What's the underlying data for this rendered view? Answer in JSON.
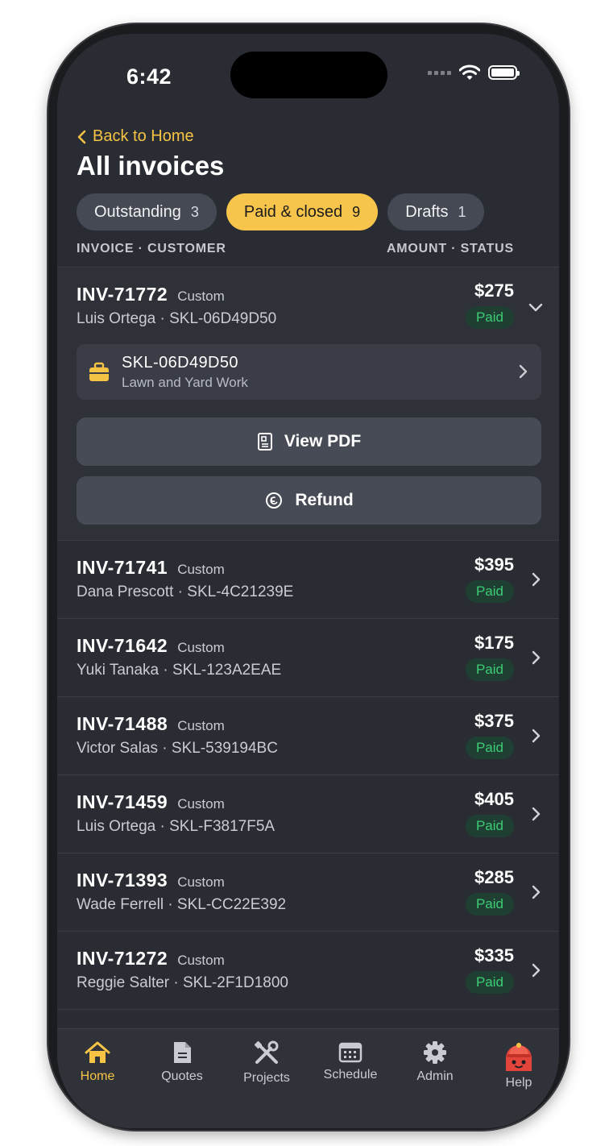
{
  "status_bar": {
    "time": "6:42"
  },
  "header": {
    "back_label": "Back to Home",
    "title": "All invoices"
  },
  "filters": [
    {
      "label": "Outstanding",
      "count": "3"
    },
    {
      "label": "Paid & closed",
      "count": "9"
    },
    {
      "label": "Drafts",
      "count": "1"
    }
  ],
  "columns": {
    "left": "INVOICE · CUSTOMER",
    "right": "AMOUNT · STATUS"
  },
  "expanded_invoice": {
    "id": "INV-71772",
    "type": "Custom",
    "sub": "Luis Ortega · SKL-06D49D50",
    "amount": "$275",
    "status": "Paid",
    "project": {
      "code": "SKL-06D49D50",
      "name": "Lawn and Yard Work"
    },
    "actions": {
      "view_pdf": "View PDF",
      "refund": "Refund"
    }
  },
  "invoices": [
    {
      "id": "INV-71741",
      "type": "Custom",
      "sub": "Dana Prescott · SKL-4C21239E",
      "amount": "$395",
      "status": "Paid"
    },
    {
      "id": "INV-71642",
      "type": "Custom",
      "sub": "Yuki Tanaka · SKL-123A2EAE",
      "amount": "$175",
      "status": "Paid"
    },
    {
      "id": "INV-71488",
      "type": "Custom",
      "sub": "Victor Salas · SKL-539194BC",
      "amount": "$375",
      "status": "Paid"
    },
    {
      "id": "INV-71459",
      "type": "Custom",
      "sub": "Luis Ortega · SKL-F3817F5A",
      "amount": "$405",
      "status": "Paid"
    },
    {
      "id": "INV-71393",
      "type": "Custom",
      "sub": "Wade Ferrell · SKL-CC22E392",
      "amount": "$285",
      "status": "Paid"
    },
    {
      "id": "INV-71272",
      "type": "Custom",
      "sub": "Reggie Salter · SKL-2F1D1800",
      "amount": "$335",
      "status": "Paid"
    }
  ],
  "tab_bar": [
    {
      "label": "Home",
      "icon": "home-icon",
      "active": true
    },
    {
      "label": "Quotes",
      "icon": "document-icon"
    },
    {
      "label": "Projects",
      "icon": "tools-icon"
    },
    {
      "label": "Schedule",
      "icon": "calendar-icon"
    },
    {
      "label": "Admin",
      "icon": "gear-icon"
    },
    {
      "label": "Help",
      "icon": "helper-mascot-icon"
    }
  ],
  "colors": {
    "accent": "#f6c445",
    "paid_text": "#3ccd75",
    "paid_bg": "#1f3f33",
    "background": "#2a2c33"
  }
}
